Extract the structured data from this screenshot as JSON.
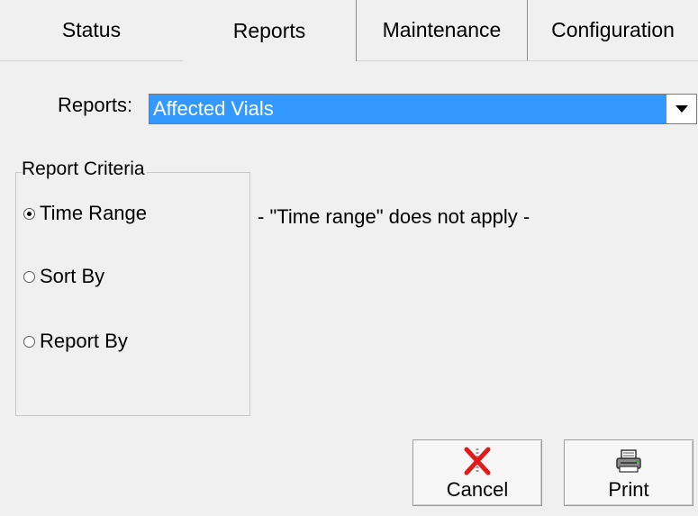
{
  "tabs": [
    {
      "label": "Status",
      "active": false
    },
    {
      "label": "Reports",
      "active": true
    },
    {
      "label": "Maintenance",
      "active": false
    },
    {
      "label": "Configuration",
      "active": false
    }
  ],
  "reports": {
    "label": "Reports:",
    "selected": "Affected Vials"
  },
  "criteria": {
    "title": "Report Criteria",
    "options": [
      {
        "label": "Time Range",
        "checked": true
      },
      {
        "label": "Sort By",
        "checked": false
      },
      {
        "label": "Report By",
        "checked": false
      }
    ],
    "message": "- \"Time range\" does not apply -"
  },
  "buttons": {
    "cancel_label": "Cancel",
    "cancel_icon": "cancel-x-icon",
    "print_label": "Print",
    "print_icon": "printer-icon"
  },
  "colors": {
    "selection": "#3399ff",
    "cancel_x": "#e11b1b"
  }
}
